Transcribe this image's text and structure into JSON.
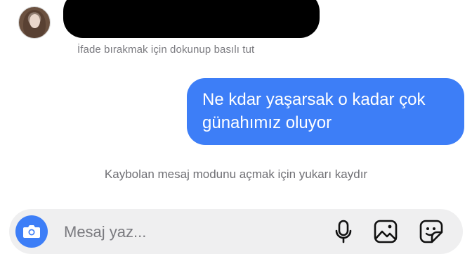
{
  "thread": {
    "hint_react": "İfade bırakmak için dokunup basılı tut",
    "sent_message": "Ne kdar yaşarsak o kadar çok\ngünahımız oluyor",
    "hint_vanish": "Kaybolan mesaj modunu açmak için yukarı kaydır"
  },
  "composer": {
    "placeholder": "Mesaj yaz...",
    "icons": [
      "camera-icon",
      "microphone-icon",
      "gallery-icon",
      "sticker-icon"
    ]
  },
  "colors": {
    "accent": "#3d7ef7",
    "composer_bg": "#efeff0",
    "hint_text": "#7b7b80"
  }
}
